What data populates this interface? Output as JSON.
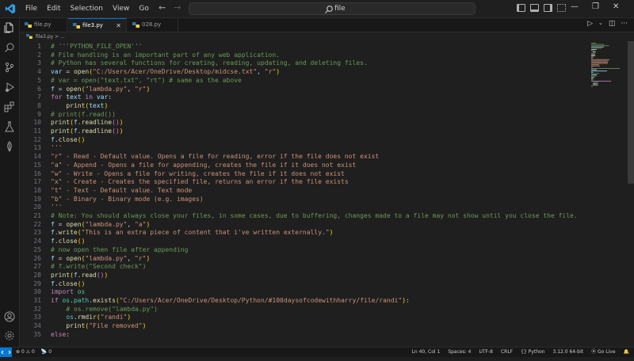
{
  "menu": [
    "File",
    "Edit",
    "Selection",
    "View",
    "Go",
    "···"
  ],
  "search": {
    "text": "file"
  },
  "tabs": [
    {
      "label": "file.py",
      "active": false
    },
    {
      "label": "file3.py",
      "active": true
    },
    {
      "label": "028.py",
      "active": false
    }
  ],
  "breadcrumb": "file3.py > ...",
  "code_lines": [
    {
      "n": "1",
      "t": "# '''PYTHON_FILE_OPEN'''"
    },
    {
      "n": "2",
      "t": "# File handling is an important part of any web application."
    },
    {
      "n": "3",
      "t": "# Python has several functions for creating, reading, updating, and deleting files."
    },
    {
      "n": "4",
      "t": "var = open(\"C:/Users/Acer/OneDrive/Desktop/midcse.txt\", \"r\")"
    },
    {
      "n": "5",
      "t": "# var = open(\"text.txt\", \"rt\") # same as the above"
    },
    {
      "n": "6",
      "t": "f = open(\"lambda.py\", \"r\")"
    },
    {
      "n": "7",
      "t": "for text in var:"
    },
    {
      "n": "8",
      "t": "    print(text)"
    },
    {
      "n": "9",
      "t": "# print(f.read())"
    },
    {
      "n": "10",
      "t": "print(f.readline())"
    },
    {
      "n": "11",
      "t": "print(f.readline())"
    },
    {
      "n": "12",
      "t": "f.close()"
    },
    {
      "n": "13",
      "t": "'''"
    },
    {
      "n": "14",
      "t": "\"r\" - Read - Default value. Opens a file for reading, error if the file does not exist"
    },
    {
      "n": "15",
      "t": "\"a\" - Append - Opens a file for appending, creates the file if it does not exist"
    },
    {
      "n": "16",
      "t": "\"w\" - Write - Opens a file for writing, creates the file if it does not exist"
    },
    {
      "n": "17",
      "t": "\"x\" - Create - Creates the specified file, returns an error if the file exists"
    },
    {
      "n": "18",
      "t": "\"t\" - Text - Default value. Text mode"
    },
    {
      "n": "19",
      "t": "\"b\" - Binary - Binary mode (e.g. images)"
    },
    {
      "n": "20",
      "t": "'''"
    },
    {
      "n": "21",
      "t": "# Note: You should always close your files, in some cases, due to buffering, changes made to a file may not show until you close the file."
    },
    {
      "n": "22",
      "t": "f = open(\"lambda.py\", \"a\")"
    },
    {
      "n": "23",
      "t": "f.write(\"This is an extra piece of content that i've written externally.\")"
    },
    {
      "n": "24",
      "t": "f.close()"
    },
    {
      "n": "25",
      "t": "# now open then file after appending"
    },
    {
      "n": "26",
      "t": "f = open(\"lambda.py\", \"r\")"
    },
    {
      "n": "27",
      "t": "# f.write(\"Second check\")"
    },
    {
      "n": "28",
      "t": "print(f.read())"
    },
    {
      "n": "29",
      "t": "f.close()"
    },
    {
      "n": "30",
      "t": "import os"
    },
    {
      "n": "31",
      "t": "if os.path.exists(\"C:/Users/Acer/OneDrive/Desktop/Python/#100daysofcodewithharry/file/randi\"):"
    },
    {
      "n": "32",
      "t": "    # os.remove(\"lambda.py\")"
    },
    {
      "n": "33",
      "t": "    os.rmdir(\"randi\")"
    },
    {
      "n": "34",
      "t": "    print(\"File removed\")"
    },
    {
      "n": "35",
      "t": "else:"
    }
  ],
  "status": {
    "errors": "0",
    "warnings": "0",
    "ports": "0",
    "ln_col": "Ln 40, Col 1",
    "spaces": "Spaces: 4",
    "encoding": "UTF-8",
    "eol": "CRLF",
    "language": "Python",
    "interpreter": "3.12.0 64-bit",
    "golive": "Go Live"
  },
  "colors": {
    "accent": "#0078d4",
    "comment": "#6a9955",
    "string": "#ce9178",
    "keyword": "#c586c0",
    "variable": "#9cdcfe",
    "function": "#dcdcaa"
  }
}
